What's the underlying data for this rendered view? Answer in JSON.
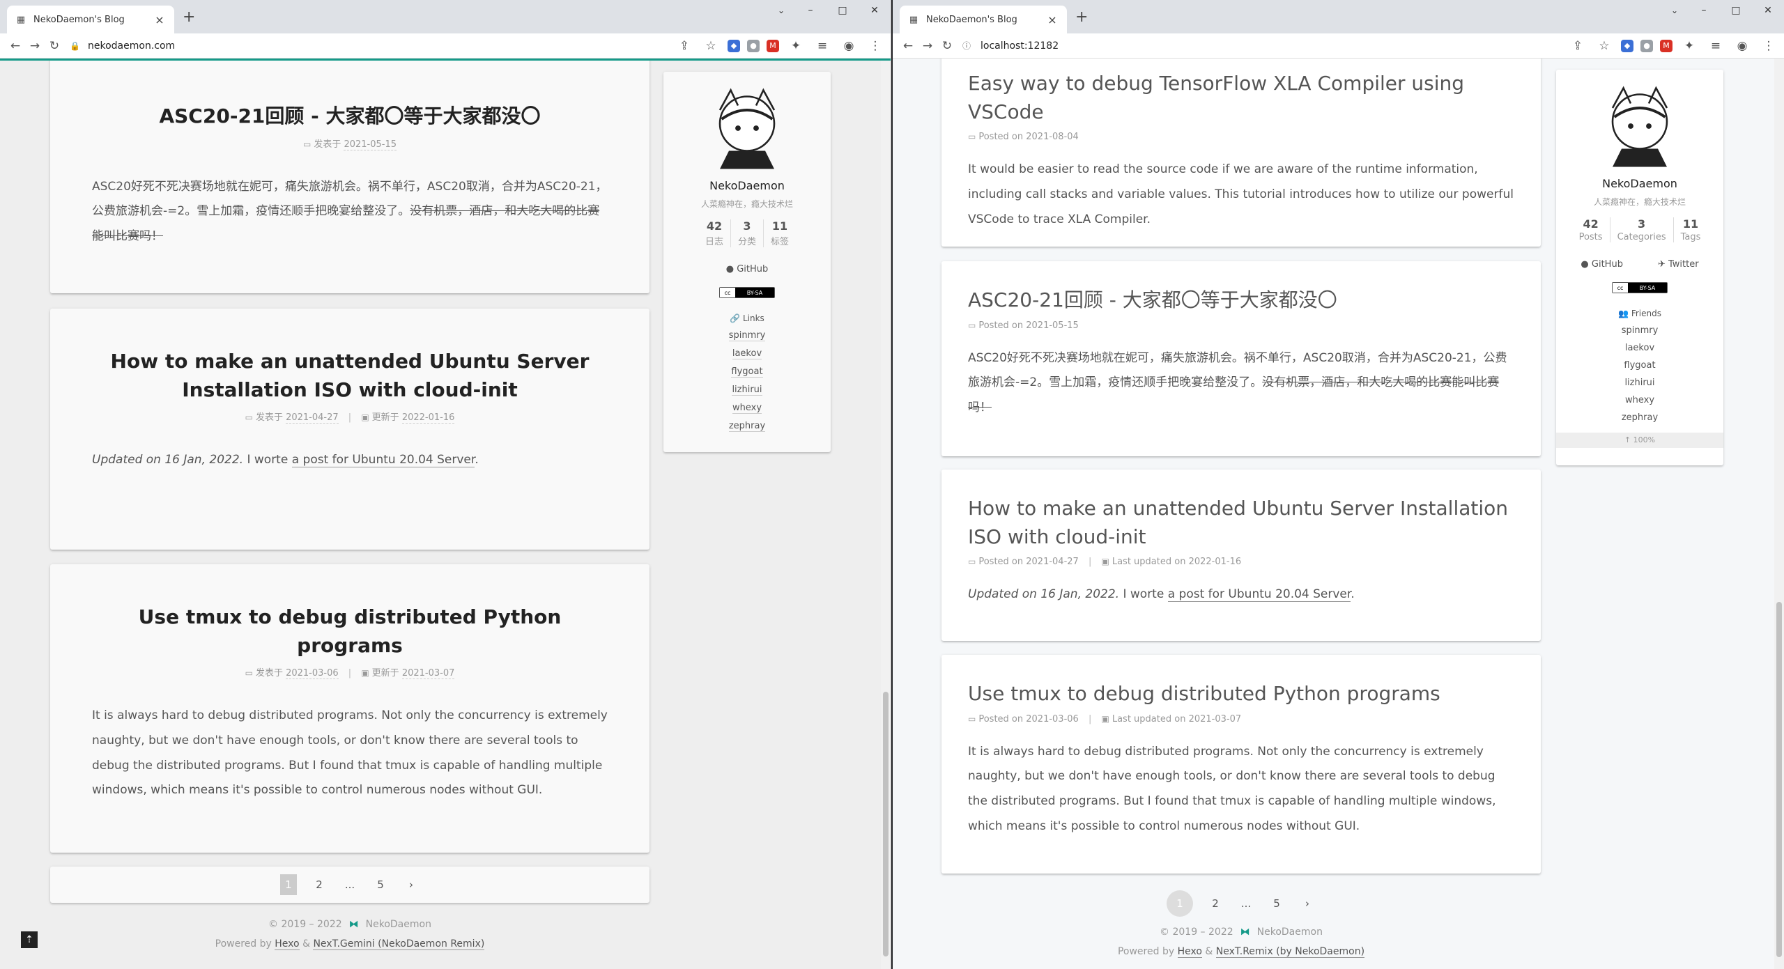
{
  "left": {
    "tab_title": "NekoDaemon's Blog",
    "url": "nekodaemon.com",
    "posts": [
      {
        "title": "ASC20-21回顾 - 大家都〇等于大家都没〇",
        "posted_label": "发表于",
        "posted": "2021-05-15",
        "body_plain": "ASC20好死不死决赛场地就在妮可，痛失旅游机会。祸不单行，ASC20取消，合并为ASC20-21，公费旅游机会-=2。雪上加霜，疫情还顺手把晚宴给整没了。",
        "body_strike": "没有机票，酒店，和大吃大喝的比赛能叫比赛吗！"
      },
      {
        "title": "How to make an unattended Ubuntu Server Installation ISO with cloud-init",
        "posted_label": "发表于",
        "posted": "2021-04-27",
        "updated_label": "更新于",
        "updated": "2022-01-16",
        "body_em": "Updated on 16 Jan, 2022.",
        "body_mid": " I worte ",
        "body_link": "a post for Ubuntu 20.04 Server",
        "body_end": "."
      },
      {
        "title": "Use tmux to debug distributed Python programs",
        "posted_label": "发表于",
        "posted": "2021-03-06",
        "updated_label": "更新于",
        "updated": "2021-03-07",
        "body": "It is always hard to debug distributed programs. Not only the concurrency is extremely naughty, but we don't have enough tools, or don't know there are several tools to debug the distributed programs. But I found that tmux is capable of handling multiple windows, which means it's possible to control numerous nodes without GUI."
      }
    ],
    "pager": {
      "p1": "1",
      "p2": "2",
      "dots": "...",
      "p5": "5",
      "next": "›"
    },
    "footer": {
      "copy": "© 2019 – 2022",
      "author": "NekoDaemon",
      "powered": "Powered by",
      "hexo": "Hexo",
      "amp": "&",
      "theme": "NexT.Gemini (NekoDaemon Remix)"
    },
    "sidebar": {
      "name": "NekoDaemon",
      "desc": "人菜瘾神在，瘾大技术烂",
      "stats": [
        {
          "n": "42",
          "l": "日志"
        },
        {
          "n": "3",
          "l": "分类"
        },
        {
          "n": "11",
          "l": "标签"
        }
      ],
      "github": "GitHub",
      "links_title": "Links",
      "links": [
        "spinmry",
        "laekov",
        "flygoat",
        "lizhirui",
        "whexy",
        "zephray"
      ]
    }
  },
  "right": {
    "tab_title": "NekoDaemon's Blog",
    "url": "localhost:12182",
    "posts": [
      {
        "title": "Easy way to debug TensorFlow XLA Compiler using VSCode",
        "posted_label": "Posted on",
        "posted": "2021-08-04",
        "body": "It would be easier to read the source code if we are aware of the runtime information, including call stacks and variable values. This tutorial introduces how to utilize our powerful VSCode to trace XLA Compiler."
      },
      {
        "title": "ASC20-21回顾 - 大家都〇等于大家都没〇",
        "posted_label": "Posted on",
        "posted": "2021-05-15",
        "body_plain": "ASC20好死不死决赛场地就在妮可，痛失旅游机会。祸不单行，ASC20取消，合并为ASC20-21，公费旅游机会-=2。雪上加霜，疫情还顺手把晚宴给整没了。",
        "body_strike": "没有机票，酒店，和大吃大喝的比赛能叫比赛吗！"
      },
      {
        "title": "How to make an unattended Ubuntu Server Installation ISO with cloud-init",
        "posted_label": "Posted on",
        "posted": "2021-04-27",
        "updated_label": "Last updated on",
        "updated": "2022-01-16",
        "body_em": "Updated on 16 Jan, 2022.",
        "body_mid": " I worte ",
        "body_link": "a post for Ubuntu 20.04 Server",
        "body_end": "."
      },
      {
        "title": "Use tmux to debug distributed Python programs",
        "posted_label": "Posted on",
        "posted": "2021-03-06",
        "updated_label": "Last updated on",
        "updated": "2021-03-07",
        "body": "It is always hard to debug distributed programs. Not only the concurrency is extremely naughty, but we don't have enough tools, or don't know there are several tools to debug the distributed programs. But I found that tmux is capable of handling multiple windows, which means it's possible to control numerous nodes without GUI."
      }
    ],
    "pager": {
      "p1": "1",
      "p2": "2",
      "dots": "...",
      "p5": "5",
      "next": "›"
    },
    "footer": {
      "copy": "© 2019 – 2022",
      "author": "NekoDaemon",
      "powered": "Powered by",
      "hexo": "Hexo",
      "amp": "&",
      "theme": "NexT.Remix (by NekoDaemon)"
    },
    "sidebar": {
      "name": "NekoDaemon",
      "desc": "人菜瘾神在，瘾大技术烂",
      "stats": [
        {
          "n": "42",
          "l": "Posts"
        },
        {
          "n": "3",
          "l": "Categories"
        },
        {
          "n": "11",
          "l": "Tags"
        }
      ],
      "github": "GitHub",
      "twitter": "Twitter",
      "links_title": "Friends",
      "links": [
        "spinmry",
        "laekov",
        "flygoat",
        "lizhirui",
        "whexy",
        "zephray"
      ],
      "back_to_top": "100%"
    }
  },
  "license_badge": "BY-SA",
  "accent": "#159a89"
}
